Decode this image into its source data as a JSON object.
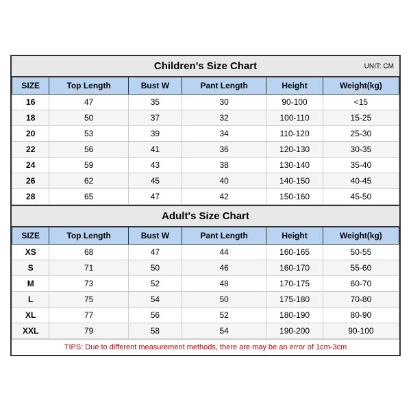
{
  "children_title": "Children's Size Chart",
  "adult_title": "Adult's Size Chart",
  "unit": "UNIT: CM",
  "tips": "TIPS: Due to different measurement methods, there are may be an error of 1cm-3cm",
  "headers": [
    "SIZE",
    "Top Length",
    "Bust W",
    "Pant Length",
    "Height",
    "Weight(kg)"
  ],
  "children_rows": [
    [
      "16",
      "47",
      "35",
      "30",
      "90-100",
      "<15"
    ],
    [
      "18",
      "50",
      "37",
      "32",
      "100-110",
      "15-25"
    ],
    [
      "20",
      "53",
      "39",
      "34",
      "110-120",
      "25-30"
    ],
    [
      "22",
      "56",
      "41",
      "36",
      "120-130",
      "30-35"
    ],
    [
      "24",
      "59",
      "43",
      "38",
      "130-140",
      "35-40"
    ],
    [
      "26",
      "62",
      "45",
      "40",
      "140-150",
      "40-45"
    ],
    [
      "28",
      "65",
      "47",
      "42",
      "150-160",
      "45-50"
    ]
  ],
  "adult_rows": [
    [
      "XS",
      "68",
      "47",
      "44",
      "160-165",
      "50-55"
    ],
    [
      "S",
      "71",
      "50",
      "46",
      "160-170",
      "55-60"
    ],
    [
      "M",
      "73",
      "52",
      "48",
      "170-175",
      "60-70"
    ],
    [
      "L",
      "75",
      "54",
      "50",
      "175-180",
      "70-80"
    ],
    [
      "XL",
      "77",
      "56",
      "52",
      "180-190",
      "80-90"
    ],
    [
      "XXL",
      "79",
      "58",
      "54",
      "190-200",
      "90-100"
    ]
  ]
}
